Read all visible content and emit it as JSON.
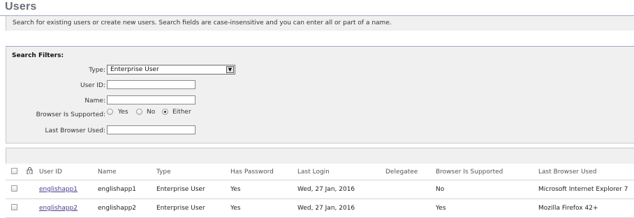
{
  "page": {
    "title": "Users",
    "description": "Search for existing users or create new users.  Search fields are case-insensitive and you can enter all or part of a name."
  },
  "filters": {
    "heading": "Search Filters:",
    "type_label": "Type:",
    "type_value": "Enterprise User",
    "user_id_label": "User ID:",
    "user_id_value": "",
    "name_label": "Name:",
    "name_value": "",
    "browser_supported_label": "Browser Is Supported:",
    "browser_options": [
      "Yes",
      "No",
      "Either"
    ],
    "browser_selected": "Either",
    "last_browser_label": "Last Browser Used:",
    "last_browser_value": ""
  },
  "table": {
    "columns": [
      "User ID",
      "Name",
      "Type",
      "Has Password",
      "Last Login",
      "Delegatee",
      "Browser Is Supported",
      "Last Browser Used"
    ],
    "rows": [
      {
        "user_id": "englishapp1",
        "name": "englishapp1",
        "type": "Enterprise User",
        "has_password": "Yes",
        "last_login": "Wed, 27 Jan, 2016",
        "delegatee": "",
        "browser_supported": "No",
        "last_browser": "Microsoft Internet Explorer 7"
      },
      {
        "user_id": "englishapp2",
        "name": "englishapp2",
        "type": "Enterprise User",
        "has_password": "Yes",
        "last_login": "Wed, 27 Jan, 2016",
        "delegatee": "",
        "browser_supported": "Yes",
        "last_browser": "Mozilla Firefox 42+"
      }
    ]
  },
  "icons": {
    "lock": "lock-icon",
    "dropdown": "chevron-down-icon"
  },
  "colors": {
    "title": "#6a6f78",
    "accent_rule": "#a9a2c8",
    "panel_bg": "#f0f0f0",
    "link": "#4a3d8c"
  }
}
